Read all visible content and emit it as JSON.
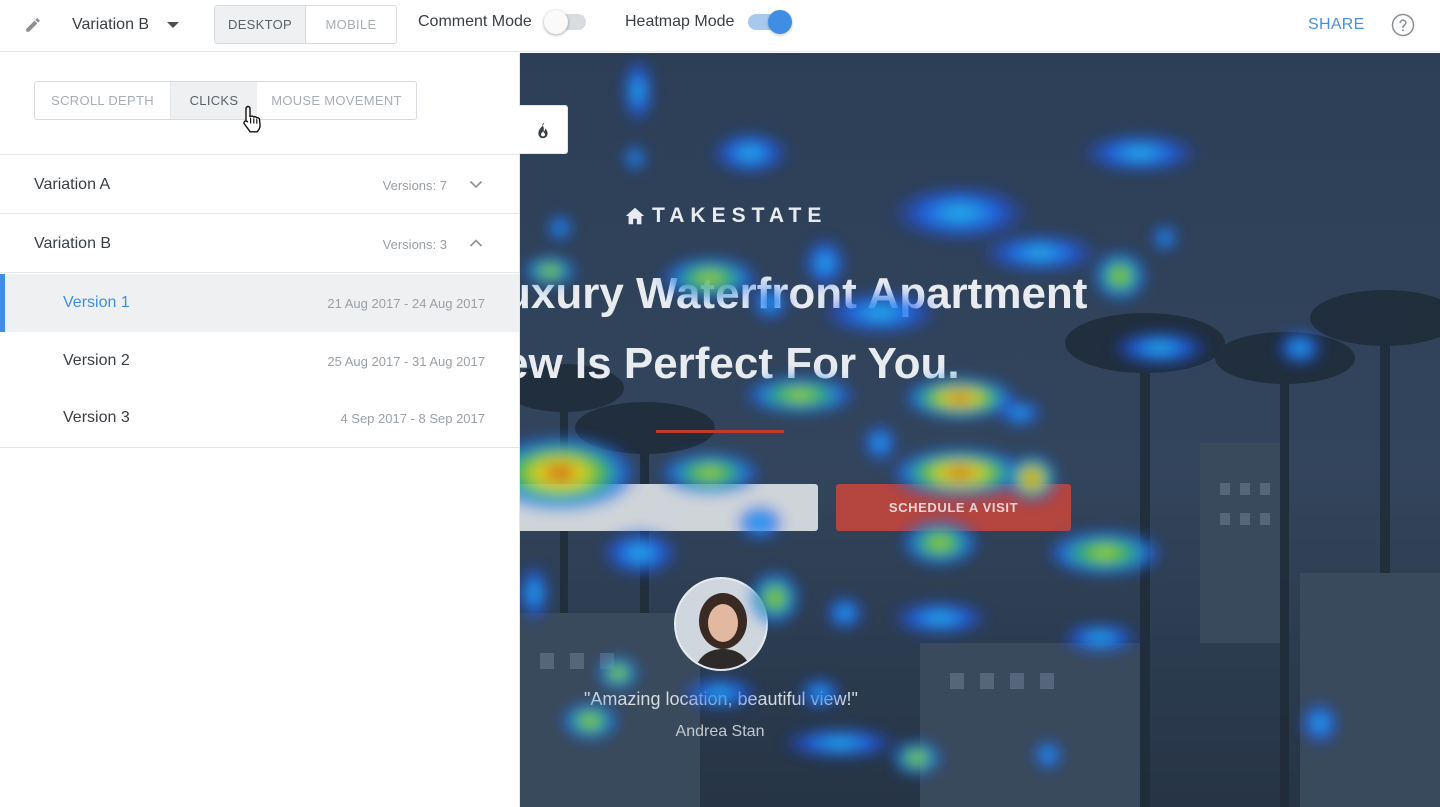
{
  "topbar": {
    "variant_label": "Variation B",
    "device_tabs": [
      "DESKTOP",
      "MOBILE"
    ],
    "comment_mode_label": "Comment Mode",
    "comment_mode_on": false,
    "heatmap_mode_label": "Heatmap Mode",
    "heatmap_mode_on": true,
    "share_label": "SHARE"
  },
  "panel": {
    "tabs": [
      "SCROLL DEPTH",
      "CLICKS",
      "MOUSE MOVEMENT"
    ],
    "active_tab": "CLICKS",
    "variations": [
      {
        "name": "Variation A",
        "versions_label": "Versions: 7",
        "expanded": false
      },
      {
        "name": "Variation B",
        "versions_label": "Versions: 3",
        "expanded": true
      }
    ],
    "versions": [
      {
        "name": "Version 1",
        "dates": "21 Aug 2017 - 24 Aug 2017",
        "active": true
      },
      {
        "name": "Version 2",
        "dates": "25 Aug 2017 - 31 Aug 2017",
        "active": false
      },
      {
        "name": "Version 3",
        "dates": "4 Sep 2017 - 8 Sep 2017",
        "active": false
      }
    ]
  },
  "preview": {
    "brand": "TAKESTATE",
    "headline_line1": "uxury Waterfront Apartment",
    "headline_line2": "ew Is Perfect For You.",
    "cta_label": "SCHEDULE A VISIT",
    "quote": "\"Amazing location, beautiful view!\"",
    "author": "Andrea Stan"
  },
  "colors": {
    "accent": "#3f8ee3",
    "share": "#4a90d9",
    "cta": "#b4453f",
    "preview_overlay": "#2c3d52"
  }
}
